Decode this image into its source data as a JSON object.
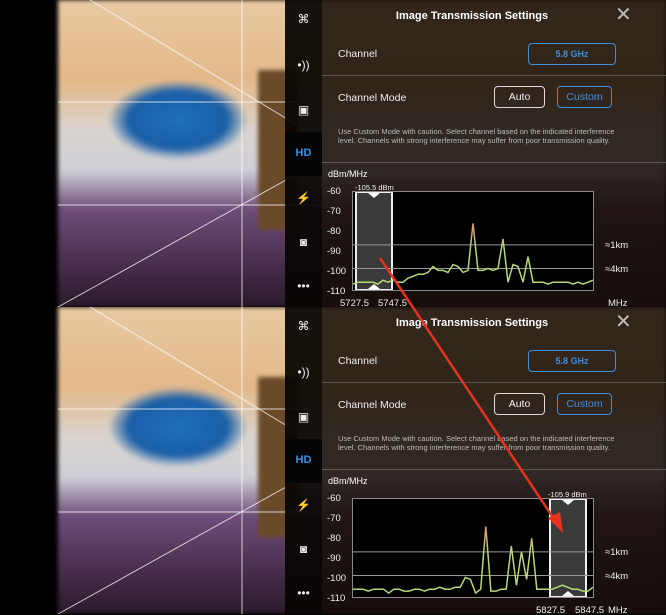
{
  "panels": [
    {
      "title": "Image Transmission Settings",
      "sidebar": [
        {
          "icon": "aircraft-icon",
          "glyph": "⌘"
        },
        {
          "icon": "signal-icon",
          "glyph": "•))"
        },
        {
          "icon": "remote-controller-icon",
          "glyph": "▣"
        },
        {
          "icon": "hd-icon",
          "glyph": "HD"
        },
        {
          "icon": "battery-icon",
          "glyph": "⚡"
        },
        {
          "icon": "camera-icon",
          "glyph": "◙"
        },
        {
          "icon": "more-icon",
          "glyph": "•••"
        }
      ],
      "channel_label": "Channel",
      "channel_value": "5.8 GHz",
      "mode_label": "Channel Mode",
      "mode_auto": "Auto",
      "mode_custom": "Custom",
      "selected_mode": "Custom",
      "note": "Use Custom Mode with caution. Select channel based on the indicated interference level. Channels with strong interference may suffer from poor transmission quality.",
      "unit": "dBm/MHz",
      "yticks": [
        "-60",
        "-70",
        "-80",
        "-90",
        "-100",
        "-110"
      ],
      "range_1km": "≈1km",
      "range_4km": "≈4km",
      "sel_dbm": "-105.5 dBm",
      "freq_low": "5727.5",
      "freq_high": "5747.5",
      "freq_unit": "MHz"
    },
    {
      "title": "Image Transmission Settings",
      "sidebar": [
        {
          "icon": "aircraft-icon",
          "glyph": "⌘"
        },
        {
          "icon": "signal-icon",
          "glyph": "•))"
        },
        {
          "icon": "remote-controller-icon",
          "glyph": "▣"
        },
        {
          "icon": "hd-icon",
          "glyph": "HD"
        },
        {
          "icon": "battery-icon",
          "glyph": "⚡"
        },
        {
          "icon": "camera-icon",
          "glyph": "◙"
        },
        {
          "icon": "more-icon",
          "glyph": "•••"
        }
      ],
      "channel_label": "Channel",
      "channel_value": "5.8 GHz",
      "mode_label": "Channel Mode",
      "mode_auto": "Auto",
      "mode_custom": "Custom",
      "selected_mode": "Custom",
      "note": "Use Custom Mode with caution. Select channel based on the indicated interference level. Channels with strong interference may suffer from poor transmission quality.",
      "unit": "dBm/MHz",
      "yticks": [
        "-60",
        "-70",
        "-80",
        "-90",
        "-100",
        "-110"
      ],
      "range_1km": "≈1km",
      "range_4km": "≈4km",
      "sel_dbm": "-105.9 dBm",
      "freq_low": "5827.5",
      "freq_high": "5847.5",
      "freq_unit": "MHz"
    }
  ],
  "chart_data": [
    {
      "type": "line",
      "ylabel": "dBm/MHz",
      "ylim": [
        -110,
        -60
      ],
      "xlabel": "MHz",
      "selected_band": "5727.5–5747.5",
      "selected_position": "left",
      "reference_lines": [
        {
          "label": "≈1km",
          "y": -87
        },
        {
          "label": "≈4km",
          "y": -99
        }
      ],
      "values": [
        -107,
        -106,
        -106,
        -106,
        -106,
        -107,
        -105,
        -106,
        -105,
        -106,
        -106,
        -104,
        -103,
        -102,
        -102,
        -101,
        -98,
        -100,
        -100,
        -101,
        -97,
        -98,
        -101,
        -100,
        -76,
        -100,
        -100,
        -99,
        -100,
        -99,
        -84,
        -106,
        -97,
        -98,
        -106,
        -93,
        -106,
        -106,
        -106,
        -107,
        -106,
        -106,
        -106,
        -106,
        -107,
        -106,
        -107,
        -106,
        -105
      ]
    },
    {
      "type": "line",
      "ylabel": "dBm/MHz",
      "ylim": [
        -110,
        -60
      ],
      "xlabel": "MHz",
      "selected_band": "5827.5–5847.5",
      "selected_position": "right",
      "reference_lines": [
        {
          "label": "≈1km",
          "y": -87
        },
        {
          "label": "≈4km",
          "y": -99
        }
      ],
      "values": [
        -106,
        -106,
        -106,
        -107,
        -106,
        -106,
        -106,
        -108,
        -106,
        -106,
        -107,
        -107,
        -106,
        -106,
        -107,
        -106,
        -106,
        -105,
        -106,
        -106,
        -105,
        -105,
        -100,
        -101,
        -108,
        -106,
        -74,
        -107,
        -107,
        -106,
        -106,
        -84,
        -104,
        -87,
        -101,
        -80,
        -106,
        -106,
        -106,
        -106,
        -105,
        -104,
        -105,
        -106,
        -106,
        -107,
        -107,
        -105
      ]
    }
  ],
  "annotation": {
    "arrow_color": "#e8321e"
  },
  "colors": {
    "accent": "#3d8fe0",
    "spectrum_low": "#b8d878",
    "spectrum_high": "#e0906a"
  }
}
